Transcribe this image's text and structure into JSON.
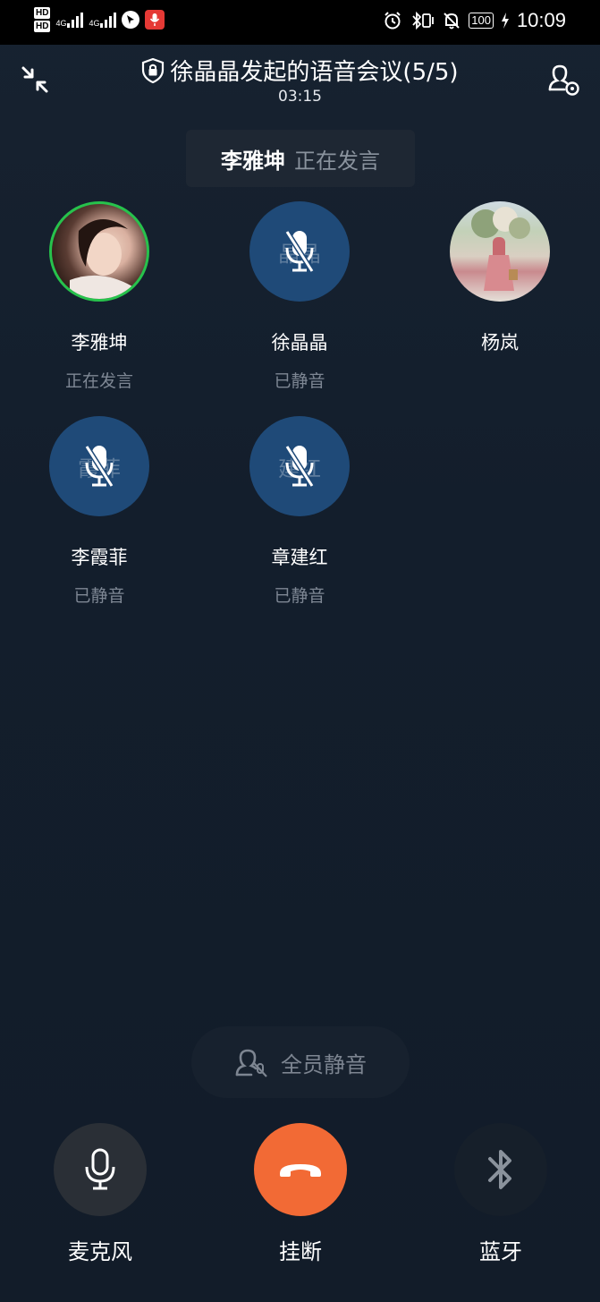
{
  "status_bar": {
    "hd1": "HD",
    "hd2": "HD",
    "net1": "4G",
    "net2": "4G",
    "battery": "100",
    "time": "10:09"
  },
  "header": {
    "title": "徐晶晶发起的语音会议(5/5)",
    "duration": "03:15"
  },
  "speaker": {
    "name": "李雅坤",
    "status": "正在发言"
  },
  "participants": [
    {
      "name": "李雅坤",
      "status": "正在发言",
      "avatar_text": ""
    },
    {
      "name": "徐晶晶",
      "status": "已静音",
      "avatar_text": "晶晶"
    },
    {
      "name": "杨岚",
      "status": "",
      "avatar_text": ""
    },
    {
      "name": "李霞菲",
      "status": "已静音",
      "avatar_text": "霞菲"
    },
    {
      "name": "章建红",
      "status": "已静音",
      "avatar_text": "建红"
    }
  ],
  "mute_all": {
    "label": "全员静音"
  },
  "controls": {
    "mic_label": "麦克风",
    "hangup_label": "挂断",
    "bluetooth_label": "蓝牙"
  },
  "colors": {
    "speaking_ring": "#27c24c",
    "muted_avatar": "#1f4a78",
    "hangup": "#f26a35",
    "background": "#131e2c"
  },
  "icons": {
    "shrink": "shrink-icon",
    "add_member": "add-member-icon",
    "lock": "lock-shield-icon",
    "mic_off": "mic-off-icon",
    "mute_all": "mute-all-icon",
    "mic": "mic-icon",
    "hangup": "phone-hangup-icon",
    "bluetooth": "bluetooth-icon"
  }
}
